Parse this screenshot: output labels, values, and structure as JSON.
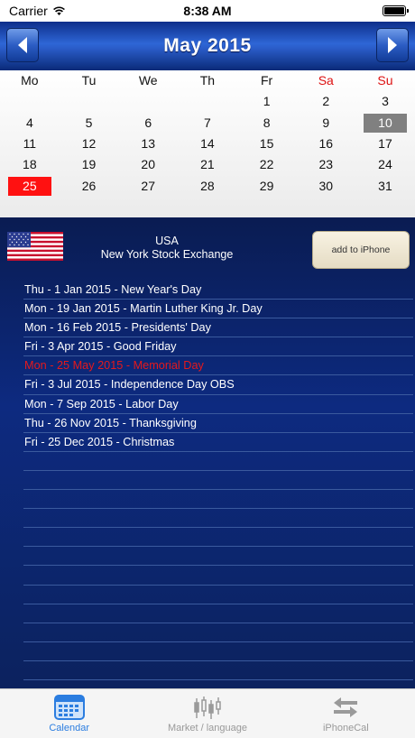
{
  "status_bar": {
    "carrier": "Carrier",
    "time": "8:38 AM"
  },
  "header": {
    "month_title": "May 2015"
  },
  "calendar": {
    "weekdays": [
      "Mo",
      "Tu",
      "We",
      "Th",
      "Fr",
      "Sa",
      "Su"
    ],
    "weeks": [
      [
        "",
        "",
        "",
        "",
        "1",
        "2",
        "3"
      ],
      [
        "4",
        "5",
        "6",
        "7",
        "8",
        "9",
        "10"
      ],
      [
        "11",
        "12",
        "13",
        "14",
        "15",
        "16",
        "17"
      ],
      [
        "18",
        "19",
        "20",
        "21",
        "22",
        "23",
        "24"
      ],
      [
        "25",
        "26",
        "27",
        "28",
        "29",
        "30",
        "31"
      ]
    ],
    "today": "10",
    "holiday": "25"
  },
  "exchange": {
    "country": "USA",
    "name": "New York Stock Exchange",
    "add_button_label": "add to iPhone"
  },
  "holidays": [
    "Thu - 1 Jan 2015 - New Year's Day",
    "Mon - 19 Jan 2015 - Martin Luther King Jr. Day",
    "Mon - 16 Feb 2015 - Presidents' Day",
    "Fri - 3 Apr 2015 - Good Friday",
    "Mon - 25 May 2015 - Memorial Day",
    "Fri - 3 Jul 2015 - Independence Day OBS",
    "Mon - 7 Sep 2015 - Labor Day",
    "Thu - 26 Nov 2015 - Thanksgiving",
    "Fri - 25 Dec 2015 - Christmas"
  ],
  "highlighted_holiday_index": 4,
  "tabs": [
    {
      "label": "Calendar",
      "icon": "calendar-icon",
      "active": true
    },
    {
      "label": "Market / language",
      "icon": "candlestick-chart-icon",
      "active": false
    },
    {
      "label": "iPhoneCal",
      "icon": "sync-arrows-icon",
      "active": false
    }
  ],
  "colors": {
    "weekend_header": "#dd1111",
    "today_bg": "#808080",
    "holiday_bg": "#ff1111",
    "highlight_text": "#e5191c",
    "tab_active": "#2b7de0",
    "tab_inactive": "#999999"
  }
}
